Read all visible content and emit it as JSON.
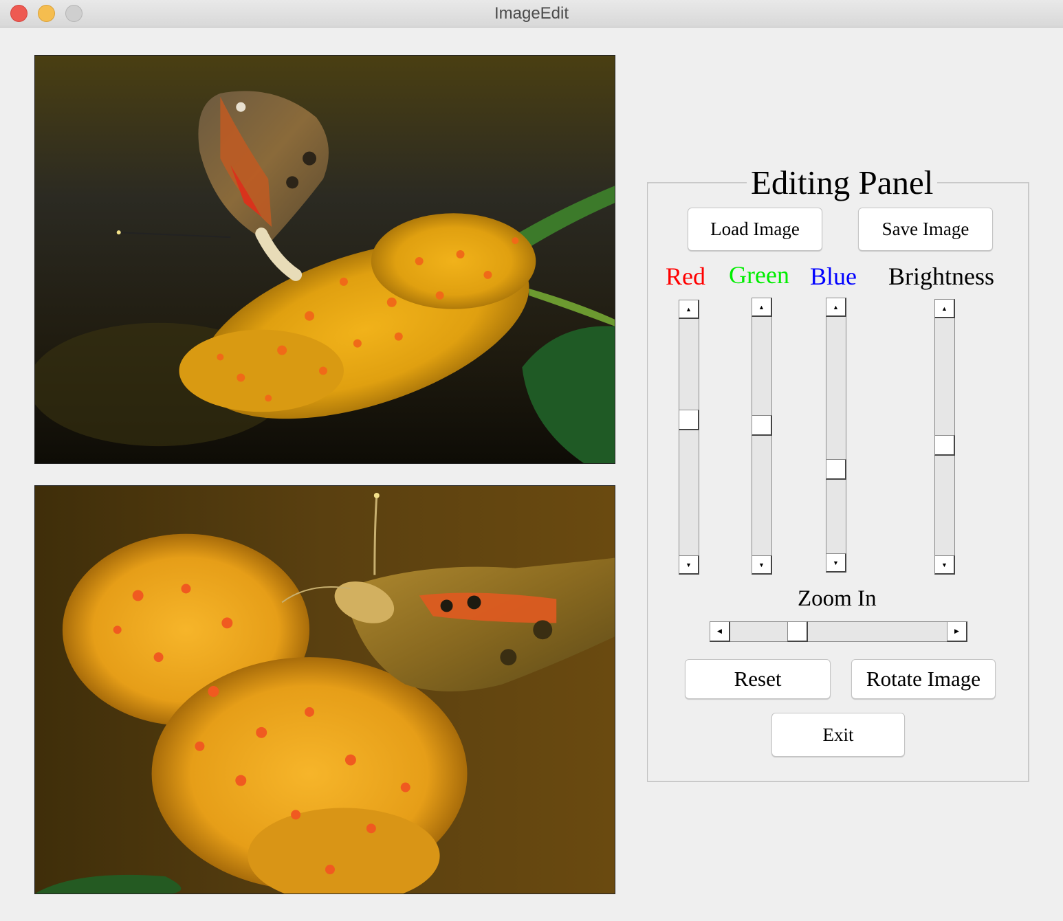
{
  "window": {
    "title": "ImageEdit"
  },
  "images": {
    "top": {
      "subject": "butterfly on yellow flower cluster"
    },
    "bottom": {
      "subject": "butterfly on yellow flower cluster, rotated"
    }
  },
  "panel": {
    "title": "Editing Panel",
    "load_label": "Load Image",
    "save_label": "Save Image",
    "reset_label": "Reset",
    "rotate_label": "Rotate Image",
    "exit_label": "Exit",
    "zoom_label": "Zoom In",
    "zoom_level": 0.29,
    "sliders": [
      {
        "label": "Red",
        "color": "#ff0000",
        "level": 0.58
      },
      {
        "label": "Green",
        "color": "#00ee00",
        "level": 0.55
      },
      {
        "label": "Blue",
        "color": "#0000ff",
        "level": 0.34
      },
      {
        "label": "Brightness",
        "color": "#000000",
        "level": 0.46
      }
    ]
  },
  "colors": {
    "window_bg": "#efefef",
    "button_bg": "#ffffff",
    "track_bg": "#e6e6e6"
  }
}
